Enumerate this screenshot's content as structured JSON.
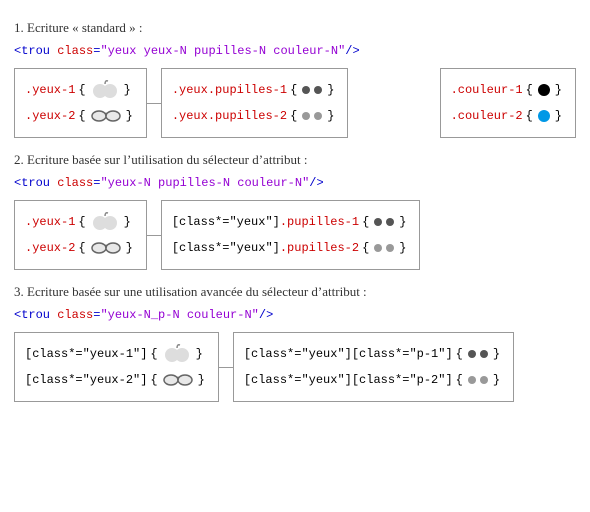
{
  "sec1": {
    "title": "1. Ecriture « standard » :",
    "code_tag_open": "<trou",
    "code_attr": "class",
    "code_val": "\"yeux yeux-N pupilles-N couleur-N\"",
    "code_tag_close": "/>",
    "boxA": {
      "l1_sel": ".yeux-1",
      "l2_sel": ".yeux-2"
    },
    "boxB": {
      "l1_a": ".yeux",
      "l1_b": ".pupilles-1",
      "l2_a": ".yeux",
      "l2_b": ".pupilles-2"
    },
    "boxC": {
      "l1_sel": ".couleur-1",
      "l2_sel": ".couleur-2"
    }
  },
  "sec2": {
    "title": "2. Ecriture basée sur l’utilisation du sélecteur d’attribut :",
    "code_tag_open": "<trou",
    "code_attr": "class",
    "code_val": "\"yeux-N pupilles-N couleur-N\"",
    "code_tag_close": "/>",
    "boxA": {
      "l1_sel": ".yeux-1",
      "l2_sel": ".yeux-2"
    },
    "boxB": {
      "l1_a": "[class*=\"yeux\"]",
      "l1_b": ".pupilles-1",
      "l2_a": "[class*=\"yeux\"]",
      "l2_b": ".pupilles-2"
    }
  },
  "sec3": {
    "title": "3. Ecriture basée sur une utilisation avancée du sélecteur d’attribut :",
    "code_tag_open": "<trou",
    "code_attr": "class",
    "code_val": "\"yeux-N_p-N couleur-N\"",
    "code_tag_close": "/>",
    "boxA": {
      "l1_sel": "[class*=\"yeux-1\"]",
      "l2_sel": "[class*=\"yeux-2\"]"
    },
    "boxB": {
      "l1": "[class*=\"yeux\"][class*=\"p-1\"]",
      "l2": "[class*=\"yeux\"][class*=\"p-2\"]"
    }
  }
}
